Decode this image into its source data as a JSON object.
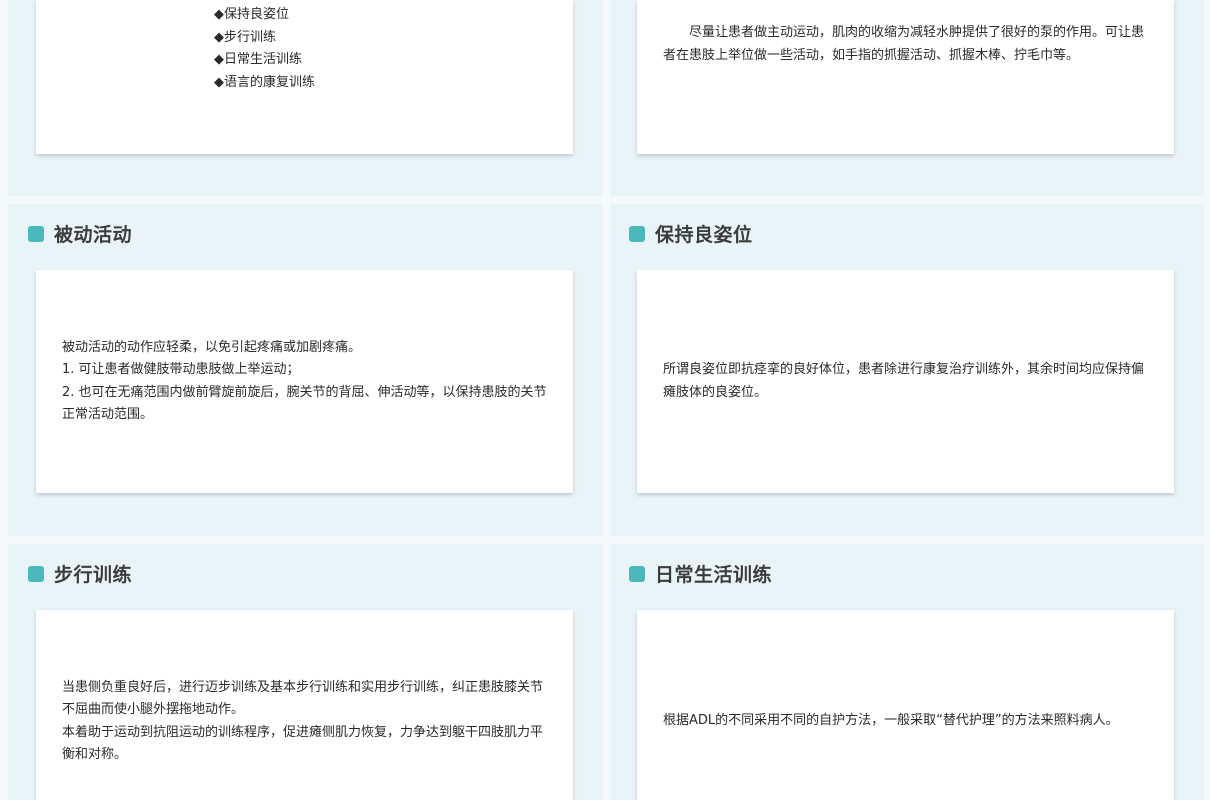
{
  "colors": {
    "accent": "#4bb8bb",
    "panel_bg": "#e9f4f9",
    "card_bg": "#ffffff",
    "heading_text": "#3c3c3c",
    "body_text": "#2a2a2a"
  },
  "overview": {
    "bullets": [
      "◆保持良姿位",
      "◆步行训练",
      "◆日常生活训练",
      "◆语言的康复训练"
    ]
  },
  "active": {
    "paragraph": "尽量让患者做主动运动，肌肉的收缩为减轻水肿提供了很好的泵的作用。可让患者在患肢上举位做一些活动，如手指的抓握活动、抓握木棒、拧毛巾等。"
  },
  "passive": {
    "title": "被动活动",
    "lines": [
      "被动活动的动作应轻柔，以免引起疼痛或加剧疼痛。",
      "1. 可让患者做健肢带动患肢做上举运动；",
      "2. 也可在无痛范围内做前臂旋前旋后，腕关节的背屈、伸活动等，以保持患肢的关节正常活动范围。"
    ]
  },
  "posture": {
    "title": "保持良姿位",
    "paragraph": "所谓良姿位即抗痉挛的良好体位，患者除进行康复治疗训练外，其余时间均应保持偏瘫肢体的良姿位。"
  },
  "walking": {
    "title": "步行训练",
    "lines": [
      "当患侧负重良好后，进行迈步训练及基本步行训练和实用步行训练，纠正患肢膝关节不屈曲而使小腿外摆拖地动作。",
      "本着助于运动到抗阻运动的训练程序，促进瘫侧肌力恢复，力争达到躯干四肢肌力平衡和对称。"
    ]
  },
  "daily": {
    "title": "日常生活训练",
    "paragraph": "根据ADL的不同采用不同的自护方法，一般采取“替代护理”的方法来照料病人。"
  }
}
